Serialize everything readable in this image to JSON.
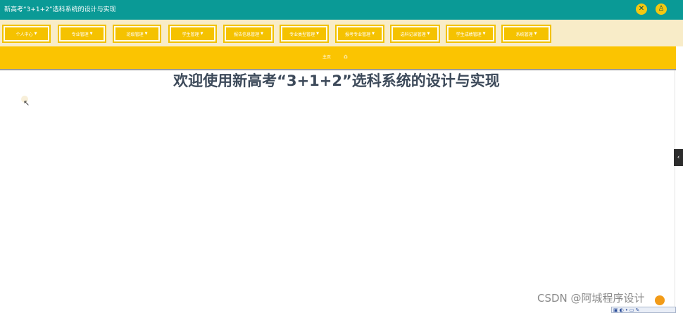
{
  "header": {
    "title": "新高考“3+1+2”选科系统的设计与实现",
    "icons": [
      "close-circle-icon",
      "user-icon"
    ]
  },
  "nav": {
    "items": [
      {
        "label": "个人中心"
      },
      {
        "label": "专业管理"
      },
      {
        "label": "班级管理"
      },
      {
        "label": "学生管理"
      },
      {
        "label": "报告信息管理"
      },
      {
        "label": "专业类型管理"
      },
      {
        "label": "报考专业管理"
      },
      {
        "label": "选科记录管理"
      },
      {
        "label": "学生成绩管理"
      },
      {
        "label": "系统管理"
      }
    ]
  },
  "breadcrumb": {
    "home_label": "主页",
    "home_icon": "home-icon"
  },
  "main": {
    "welcome": "欢迎使用新高考“3+1+2”选科系统的设计与实现"
  },
  "watermark": "CSDN @阿城程序设计",
  "colors": {
    "topbar": "#0a9a96",
    "nav_bg": "#f8ecc8",
    "nav_item": "#f5c200",
    "subbar": "#fbc401",
    "welcome_text": "#3d4a5a"
  }
}
